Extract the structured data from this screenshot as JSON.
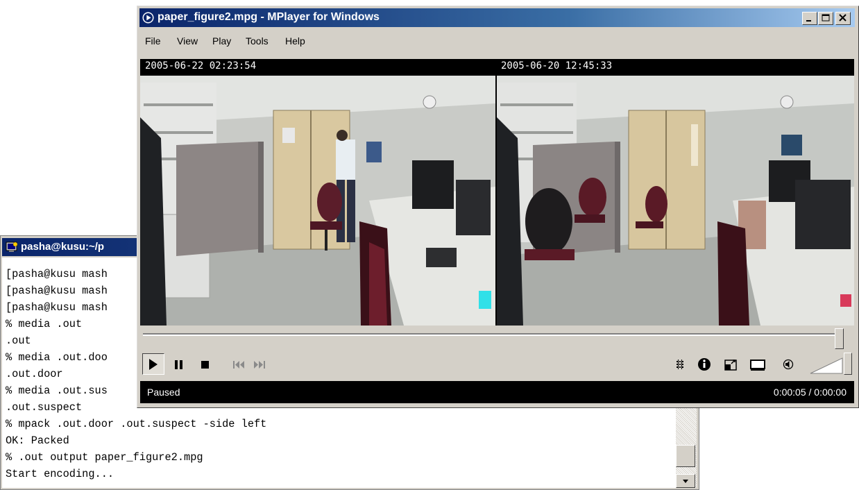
{
  "terminal": {
    "title": "pasha@kusu:~/p",
    "lines": [
      "[pasha@kusu mash",
      "[pasha@kusu mash",
      "[pasha@kusu mash",
      "% media .out",
      ".out",
      "% media .out.doo",
      ".out.door",
      "% media .out.sus",
      ".out.suspect",
      "% mpack .out.door .out.suspect -side left",
      "OK: Packed",
      "% .out output paper_figure2.mpg",
      "Start encoding..."
    ]
  },
  "player": {
    "title": "paper_figure2.mpg - MPlayer for Windows",
    "menu": [
      "File",
      "View",
      "Play",
      "Tools",
      "Help"
    ],
    "left_timestamp": "2005-06-22 02:23:54",
    "right_timestamp": "2005-06-20 12:45:33",
    "status": "Paused",
    "time": "0:00:05 / 0:00:00",
    "seek_progress": 1.0,
    "volume_level": 0.0
  },
  "icons": {
    "play": "play-icon",
    "pause": "pause-icon",
    "stop": "stop-icon",
    "previous": "skip-back-icon",
    "next": "skip-forward-icon",
    "playlist": "playlist-icon",
    "info": "info-icon",
    "fullscreen": "fullscreen-icon",
    "compact": "compact-view-icon",
    "volume": "speaker-icon"
  },
  "colors": {
    "title_bar": "#0a246a",
    "window_face": "#d4d0c8",
    "status_bg": "#000000"
  }
}
